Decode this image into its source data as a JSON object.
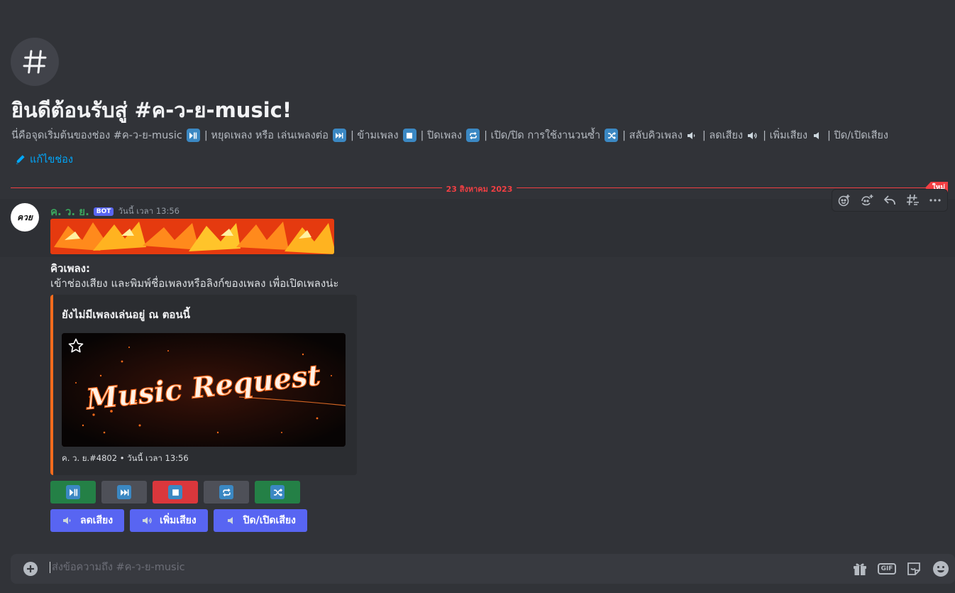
{
  "welcome": {
    "title": "ยินดีต้อนรับสู่ #ค-ว-ย-music!",
    "description_segments": [
      "นี่คือจุดเริ่มต้นของช่อง #ค-ว-ย-music",
      "| หยุดเพลง หรือ เล่นเพลงต่อ",
      "| ข้ามเพลง",
      "| ปิดเพลง",
      "| เปิด/ปิด การใช้งานวนซ้ำ",
      "| สลับคิวเพลง",
      "| ลดเสียง",
      "| เพิ่มเสียง",
      "| ปิด/เปิดเสียง"
    ],
    "edit_label": "แก้ไขช่อง"
  },
  "divider": {
    "date": "23 สิงหาคม 2023",
    "new_label": "ใหม่"
  },
  "message": {
    "avatar_text": "ควย",
    "username": "ค. ว. ย.",
    "bot_tag": "BOT",
    "timestamp": "วันนี้ เวลา 13:56",
    "line1": "คิวเพลง:",
    "line2": "เข้าช่องเสียง และพิมพ์ชื่อเพลงหรือลิงก์ของเพลง เพื่อเปิดเพลงน่ะ",
    "embed": {
      "title": "ยังไม่มีเพลงเล่นอยู่ ณ ตอนนี้",
      "image_text": "Music Request",
      "footer": "ค. ว. ย.#4802 • วันนี้ เวลา 13:56",
      "accent_color": "#f26b1d"
    },
    "buttons_row1": [
      {
        "icon": "play-pause-icon",
        "color": "#248046"
      },
      {
        "icon": "next-track-icon",
        "color": "#4e5058"
      },
      {
        "icon": "stop-icon",
        "color": "#da373c"
      },
      {
        "icon": "repeat-icon",
        "color": "#4e5058"
      },
      {
        "icon": "shuffle-icon",
        "color": "#248046"
      }
    ],
    "buttons_row2": [
      {
        "label": "ลดเสียง",
        "icon": "speaker-low-icon"
      },
      {
        "label": "เพิ่มเสียง",
        "icon": "speaker-high-icon"
      },
      {
        "label": "ปิด/เปิดเสียง",
        "icon": "speaker-mute-icon"
      }
    ]
  },
  "composer": {
    "placeholder": "ส่งข้อความถึง #ค-ว-ย-music",
    "gif_label": "GIF"
  },
  "colors": {
    "background": "#313338",
    "blurple": "#5865f2",
    "link": "#00a8fc",
    "danger": "#f23f43"
  }
}
